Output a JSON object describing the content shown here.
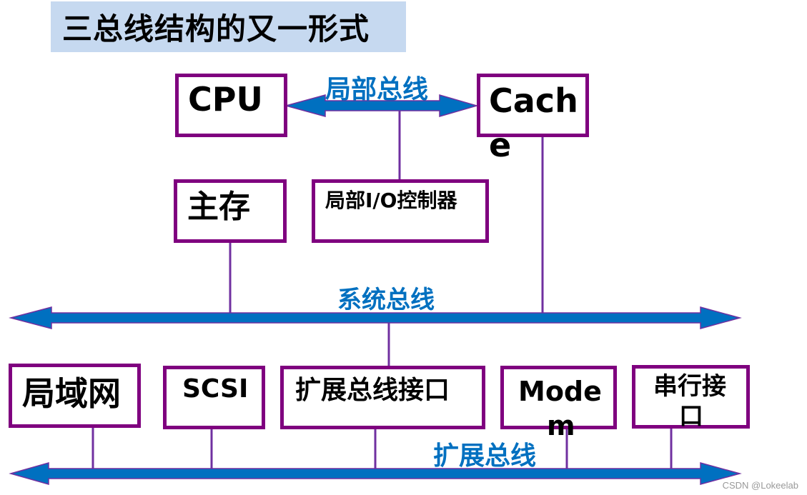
{
  "title": "三总线结构的又一形式",
  "colors": {
    "bus_fill": "#0070c0",
    "bus_outline": "#7030a0",
    "box_border": "#7f007f",
    "connector": "#7030a0",
    "title_bg": "#c6d9f0",
    "bus_label": "#0070c0"
  },
  "components": {
    "cpu": "CPU",
    "cache_line1": "Cach",
    "cache_line2": "e",
    "main_memory": "主存",
    "local_io_controller": "局部I/O控制器",
    "lan": "局域网",
    "scsi": "SCSI",
    "expansion_bus_interface": "扩展总线接口",
    "modem_line1": "Mode",
    "modem_line2": "m",
    "serial_port_line1": "串行接",
    "serial_port_line2": "口"
  },
  "buses": {
    "local_bus": "局部总线",
    "system_bus": "系统总线",
    "expansion_bus": "扩展总线"
  },
  "watermark": "CSDN @Lokeelab"
}
